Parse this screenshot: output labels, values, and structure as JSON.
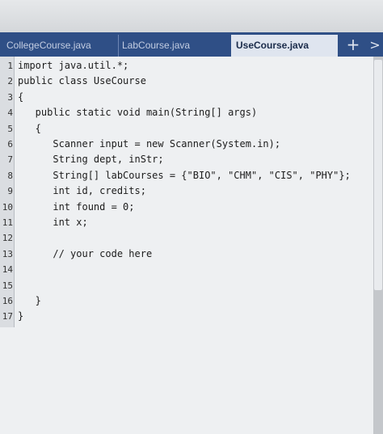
{
  "tabs": [
    {
      "label": "CollegeCourse.java"
    },
    {
      "label": "LabCourse.java"
    },
    {
      "label": "UseCourse.java"
    }
  ],
  "tab_actions": {
    "add_label": "+",
    "more_label": ">"
  },
  "editor": {
    "lines": [
      {
        "num": "1",
        "text": "import java.util.*;"
      },
      {
        "num": "2",
        "text": "public class UseCourse"
      },
      {
        "num": "3",
        "text": "{"
      },
      {
        "num": "4",
        "text": "   public static void main(String[] args)"
      },
      {
        "num": "5",
        "text": "   {"
      },
      {
        "num": "6",
        "text": "      Scanner input = new Scanner(System.in);"
      },
      {
        "num": "7",
        "text": "      String dept, inStr;"
      },
      {
        "num": "8",
        "text": "      String[] labCourses = {\"BIO\", \"CHM\", \"CIS\", \"PHY\"};"
      },
      {
        "num": "9",
        "text": "      int id, credits;"
      },
      {
        "num": "10",
        "text": "      int found = 0;"
      },
      {
        "num": "11",
        "text": "      int x;"
      },
      {
        "num": "12",
        "text": ""
      },
      {
        "num": "13",
        "text": "      // your code here"
      },
      {
        "num": "14",
        "text": ""
      },
      {
        "num": "15",
        "text": ""
      },
      {
        "num": "16",
        "text": "   }"
      },
      {
        "num": "17",
        "text": "}"
      }
    ]
  }
}
